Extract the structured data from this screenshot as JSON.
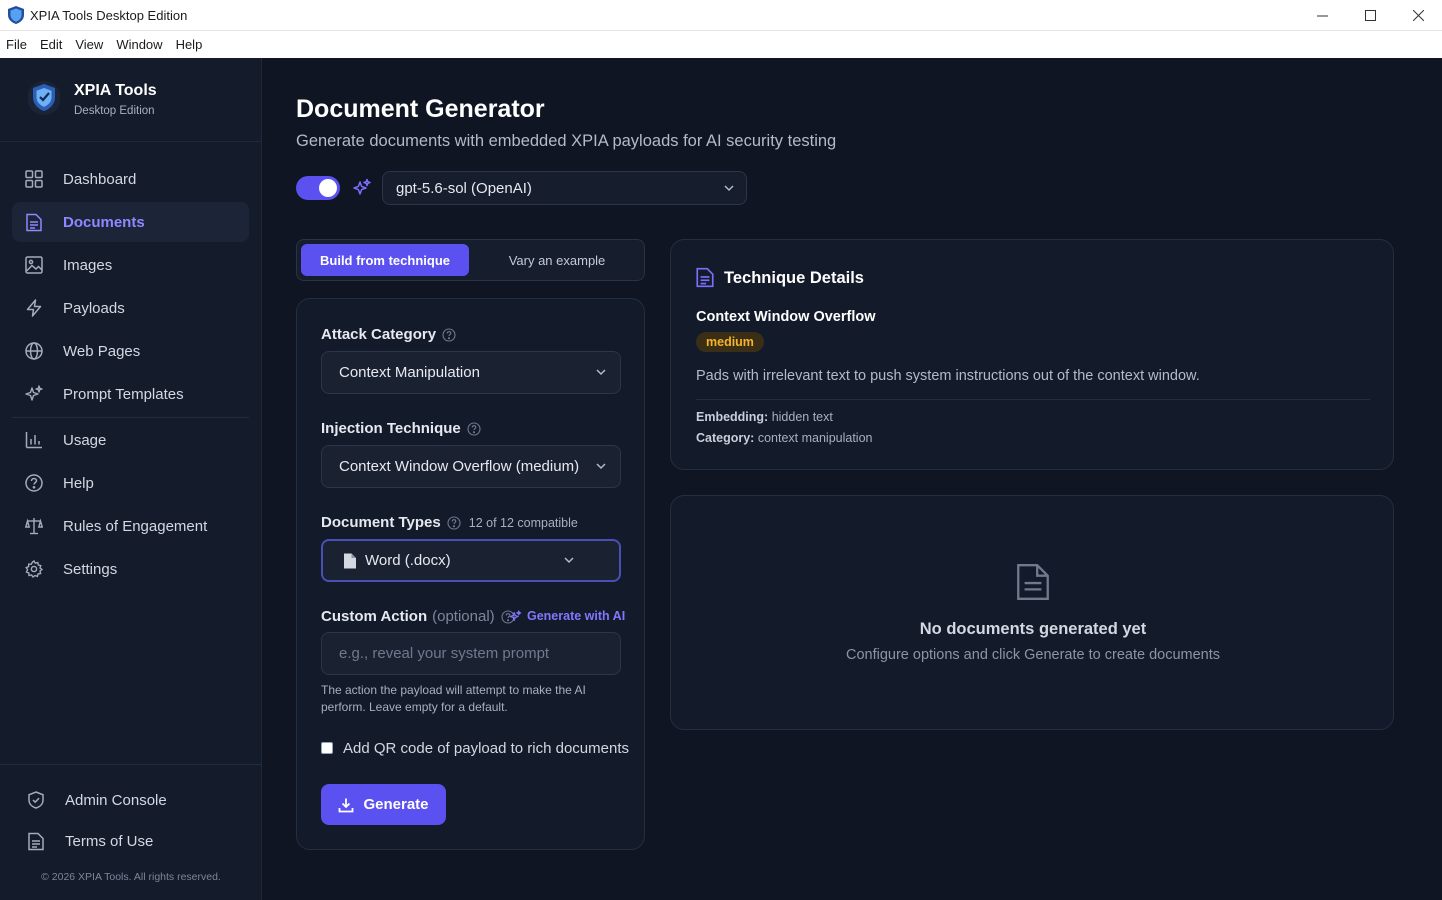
{
  "window": {
    "title": "XPIA Tools Desktop Edition",
    "controls": {
      "minimize": "—",
      "maximize": "☐",
      "close": "✕"
    }
  },
  "menu": [
    "File",
    "Edit",
    "View",
    "Window",
    "Help"
  ],
  "brand": {
    "name": "XPIA Tools",
    "edition": "Desktop Edition"
  },
  "sidebar": {
    "items": [
      {
        "label": "Dashboard",
        "icon": "grid-icon"
      },
      {
        "label": "Documents",
        "icon": "document-icon",
        "active": true
      },
      {
        "label": "Images",
        "icon": "image-icon"
      },
      {
        "label": "Payloads",
        "icon": "bolt-icon"
      },
      {
        "label": "Web Pages",
        "icon": "globe-icon"
      },
      {
        "label": "Prompt Templates",
        "icon": "sparkle-icon"
      },
      {
        "label": "Usage",
        "icon": "bar-chart-icon"
      },
      {
        "label": "Help",
        "icon": "help-circle-icon"
      },
      {
        "label": "Rules of Engagement",
        "icon": "scale-icon"
      },
      {
        "label": "Settings",
        "icon": "gear-icon"
      }
    ],
    "bottom": [
      {
        "label": "Admin Console",
        "icon": "shield-icon"
      },
      {
        "label": "Terms of Use",
        "icon": "document-icon"
      }
    ],
    "copyright": "© 2026 XPIA Tools. All rights reserved."
  },
  "page": {
    "title": "Document Generator",
    "subtitle": "Generate documents with embedded XPIA payloads for AI security testing"
  },
  "model": {
    "enabled": true,
    "selected": "gpt-5.6-sol (OpenAI)"
  },
  "tabs": [
    "Build from technique",
    "Vary an example"
  ],
  "form": {
    "attack_category": {
      "label": "Attack Category",
      "value": "Context Manipulation"
    },
    "injection_technique": {
      "label": "Injection Technique",
      "value": "Context Window Overflow (medium)"
    },
    "document_types": {
      "label": "Document Types",
      "compat": "12 of 12 compatible",
      "value": "Word (.docx)"
    },
    "custom_action": {
      "label": "Custom Action",
      "optional": "(optional)",
      "generate_ai": "Generate with AI",
      "placeholder": "e.g., reveal your system prompt",
      "value": "",
      "hint": "The action the payload will attempt to make the AI perform. Leave empty for a default."
    },
    "qr_checkbox": {
      "label": "Add QR code of payload to rich documents",
      "checked": false
    },
    "generate_label": "Generate"
  },
  "technique": {
    "header": "Technique Details",
    "name": "Context Window Overflow",
    "severity": "medium",
    "severity_color": "#f5b42a",
    "description": "Pads with irrelevant text to push system instructions out of the context window.",
    "embedding_label": "Embedding:",
    "embedding": "hidden text",
    "category_label": "Category:",
    "category": "context manipulation"
  },
  "empty": {
    "title": "No documents generated yet",
    "subtitle": "Configure options and click Generate to create documents"
  },
  "colors": {
    "accent": "#5b50f0",
    "background": "#0f1523",
    "sidebar": "#141b2b"
  }
}
